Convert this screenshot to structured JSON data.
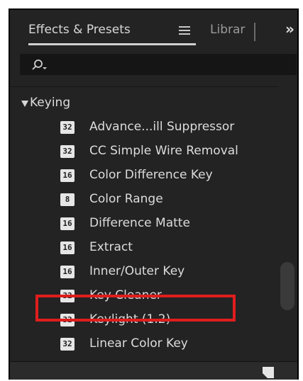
{
  "tabs": {
    "active_label": "Effects & Presets",
    "inactive_label": "Librar",
    "overflow_glyph": "»"
  },
  "search": {
    "value": "",
    "placeholder": ""
  },
  "group": {
    "label": "Keying",
    "expanded": true
  },
  "items": [
    {
      "badge": "32",
      "label": "Advance...ill Suppressor"
    },
    {
      "badge": "32",
      "label": "CC Simple Wire Removal"
    },
    {
      "badge": "16",
      "label": "Color Difference Key"
    },
    {
      "badge": "8",
      "label": "Color Range"
    },
    {
      "badge": "16",
      "label": "Difference Matte"
    },
    {
      "badge": "16",
      "label": "Extract"
    },
    {
      "badge": "16",
      "label": "Inner/Outer Key"
    },
    {
      "badge": "32",
      "label": "Key Cleaner"
    },
    {
      "badge": "32",
      "label": "Keylight (1.2)"
    },
    {
      "badge": "32",
      "label": "Linear Color Key"
    }
  ],
  "highlighted_item": "Keylight (1.2)",
  "colors": {
    "panel_bg": "#232323",
    "highlight": "#e01d1d",
    "text": "#dcdcdc"
  },
  "icons": {
    "menu": "hamburger-icon",
    "search": "search-icon",
    "overflow": "double-chevron-right-icon",
    "footer": "new-folder-icon"
  }
}
